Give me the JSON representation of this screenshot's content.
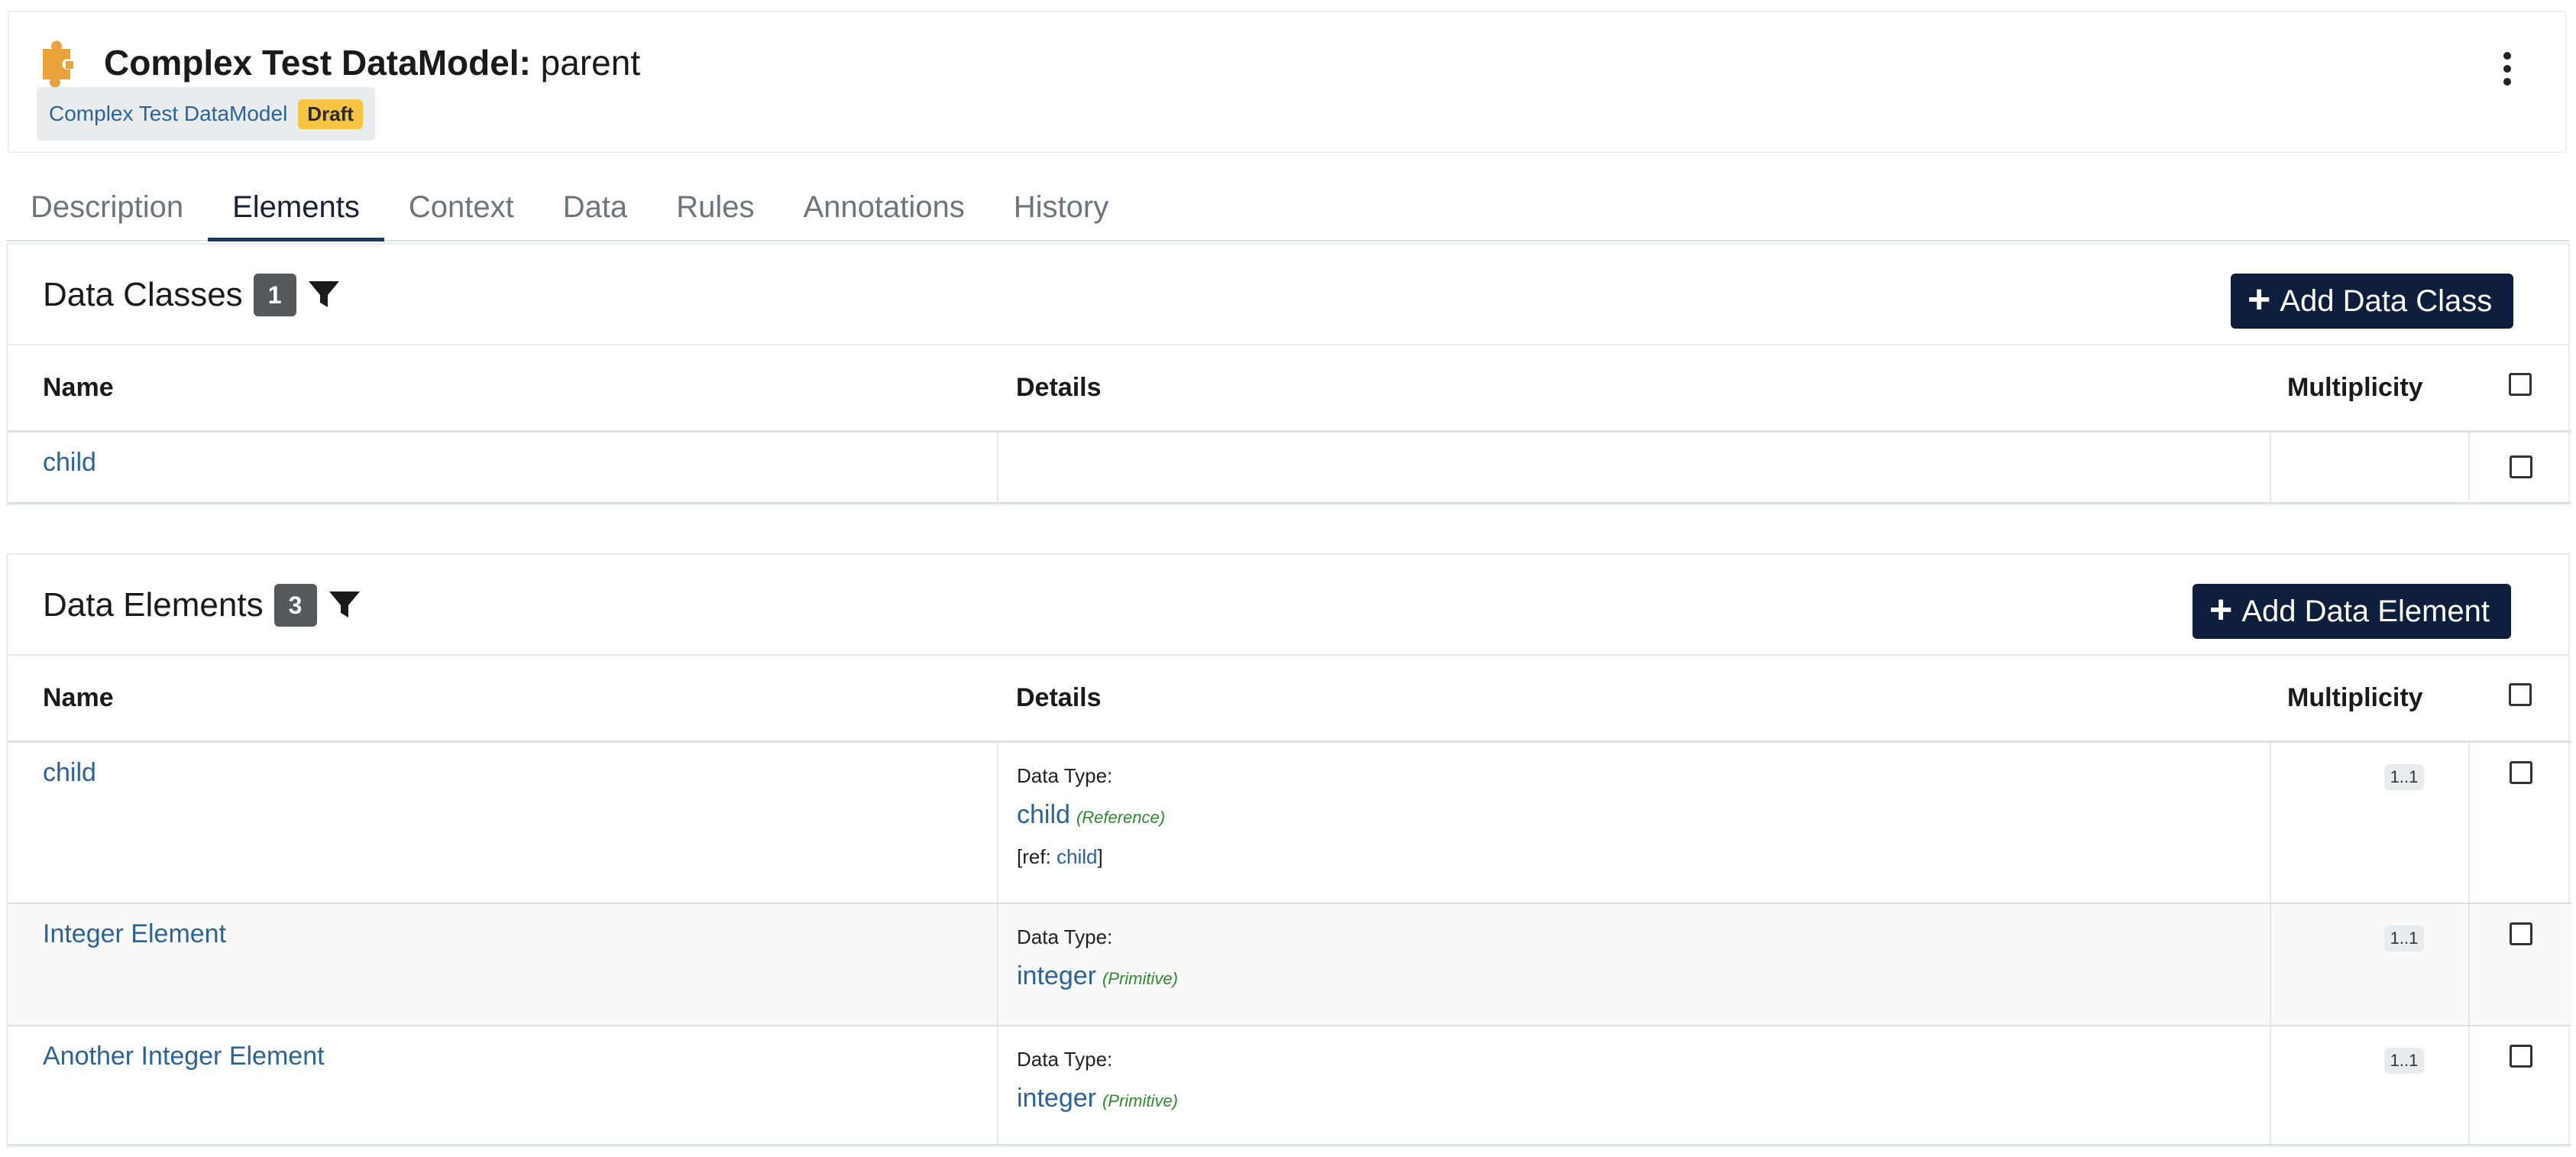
{
  "header": {
    "logo_icon": "puzzle-piece-icon",
    "title_strong": "Complex Test DataModel:",
    "title_plain": " parent",
    "breadcrumb_link": "Complex Test DataModel",
    "status_badge": "Draft",
    "menu_icon": "kebab-menu-icon"
  },
  "colors": {
    "accent": "#e8a33d",
    "primary_button": "#0d1f3c",
    "link": "#2a6396",
    "draft_badge": "#f6c343",
    "primitive_green": "#2e8b2e"
  },
  "tabs": [
    {
      "label": "Description"
    },
    {
      "label": "Elements"
    },
    {
      "label": "Context"
    },
    {
      "label": "Data"
    },
    {
      "label": "Rules"
    },
    {
      "label": "Annotations"
    },
    {
      "label": "History"
    }
  ],
  "active_tab": "Elements",
  "data_classes": {
    "title": "Data Classes",
    "count": "1",
    "add_button": "Add Data Class",
    "columns": {
      "name": "Name",
      "details": "Details",
      "multiplicity": "Multiplicity"
    },
    "rows": [
      {
        "name": "child"
      }
    ]
  },
  "data_elements": {
    "title": "Data Elements",
    "count": "3",
    "add_button": "Add Data Element",
    "columns": {
      "name": "Name",
      "details": "Details",
      "multiplicity": "Multiplicity"
    },
    "rows": [
      {
        "name": "child",
        "data_type_label": "Data Type:",
        "data_type": "child",
        "data_type_kind": "(Reference)",
        "ref_prefix": "[ref: ",
        "ref_link": "child",
        "ref_suffix": "]",
        "multiplicity": "1..1"
      },
      {
        "name": "Integer Element",
        "data_type_label": "Data Type:",
        "data_type": "integer",
        "data_type_kind": "(Primitive)",
        "multiplicity": "1..1"
      },
      {
        "name": "Another Integer Element",
        "data_type_label": "Data Type:",
        "data_type": "integer",
        "data_type_kind": "(Primitive)",
        "multiplicity": "1..1"
      }
    ]
  }
}
